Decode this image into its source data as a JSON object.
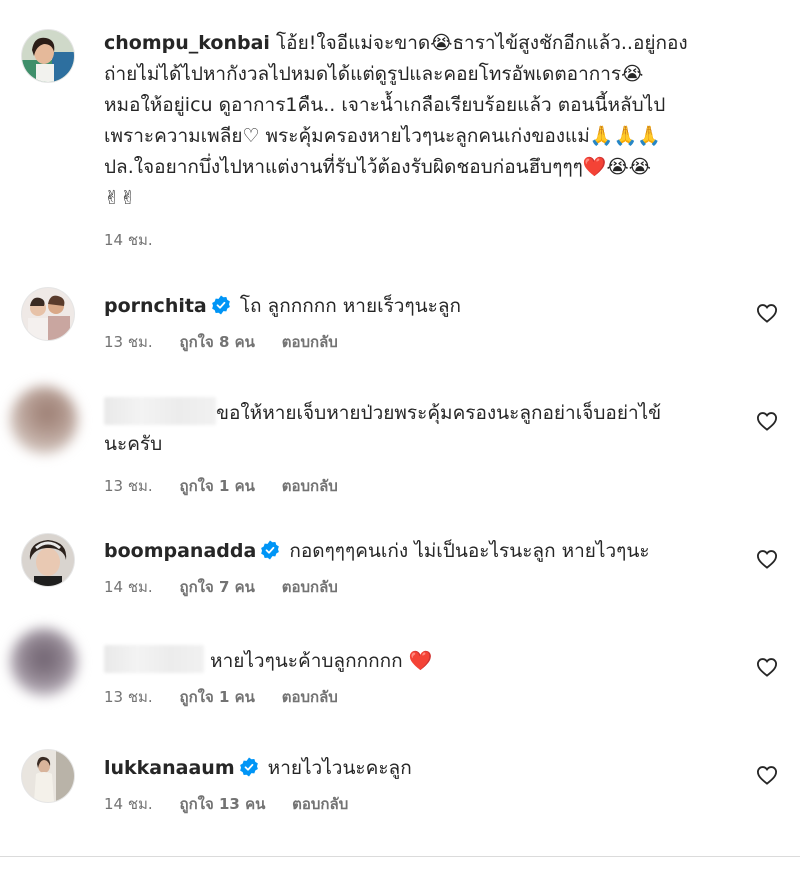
{
  "colors": {
    "text": "#262626",
    "muted": "#737373",
    "verified": "#0095f6",
    "heart": "#e0245e"
  },
  "comments": [
    {
      "username": "chompu_konbai",
      "lines": [
        "โอ้ย!ใจอีแม่จะขาด😭ธาราไข้สูงชักอีกแล้ว..อยู่กอง",
        "ถ่ายไม่ได้ไปหากังวลไปหมดได้แต่ดูรูปและคอยโทรอัพเดตอาการ😭",
        "หมอให้อยู่icu ดูอาการ1คืน.. เจาะน้ำเกลือเรียบร้อยแล้ว ตอนนี้หลับไป",
        "เพราะความเพลีย♡ พระคุ้มครองหายไวๆนะลูกคนเก่งของแม่🙏🙏🙏",
        "ปล.ใจอยากบึ่งไปหาแต่งานที่รับไว้ต้องรับผิดชอบก่อนฮึบๆๆๆ❤️😭😭",
        "✌✌"
      ],
      "time": "14 ชม."
    },
    {
      "username": "pornchita",
      "text": "โถ ลูกกกกก หายเร็วๆนะลูก",
      "time": "13 ชม.",
      "likes": "ถูกใจ 8 คน",
      "reply": "ตอบกลับ"
    },
    {
      "username": "",
      "text_line1": "ขอให้หายเจ็บหายป่วยพระคุ้มครองนะลูกอย่าเจ็บอย่าไข้",
      "text_line2": "นะครับ",
      "time": "13 ชม.",
      "likes": "ถูกใจ 1 คน",
      "reply": "ตอบกลับ"
    },
    {
      "username": "boompanadda",
      "text": "กอดๆๆๆคนเก่ง ไม่เป็นอะไรนะลูก หายไวๆนะ",
      "time": "14 ชม.",
      "likes": "ถูกใจ 7 คน",
      "reply": "ตอบกลับ"
    },
    {
      "username": "",
      "text": "หายไวๆนะค้าบลูกกกกก ❤️",
      "time": "13 ชม.",
      "likes": "ถูกใจ 1 คน",
      "reply": "ตอบกลับ"
    },
    {
      "username": "lukkanaaum",
      "text": "หายไวไวนะคะลูก",
      "time": "14 ชม.",
      "likes": "ถูกใจ 13 คน",
      "reply": "ตอบกลับ"
    }
  ]
}
